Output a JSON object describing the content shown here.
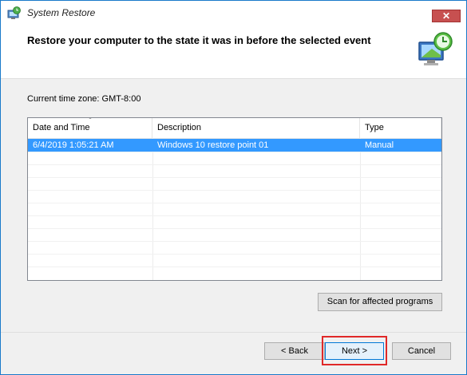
{
  "window": {
    "title": "System Restore",
    "close_label": "✕"
  },
  "header": {
    "heading": "Restore your computer to the state it was in before the selected event"
  },
  "timezone_label": "Current time zone: GMT-8:00",
  "table": {
    "columns": [
      "Date and Time",
      "Description",
      "Type"
    ],
    "rows": [
      {
        "date": "6/4/2019 1:05:21 AM",
        "description": "Windows 10 restore point 01",
        "type": "Manual",
        "selected": true
      }
    ]
  },
  "buttons": {
    "scan": "Scan for affected programs",
    "back": "< Back",
    "next": "Next >",
    "cancel": "Cancel"
  },
  "colors": {
    "selection": "#3399ff",
    "highlight_border": "#e02828",
    "title_border": "#1979ca"
  },
  "icons": [
    "system-restore-icon",
    "restore-clock-monitor-icon",
    "sort-arrow-icon",
    "close-icon"
  ]
}
